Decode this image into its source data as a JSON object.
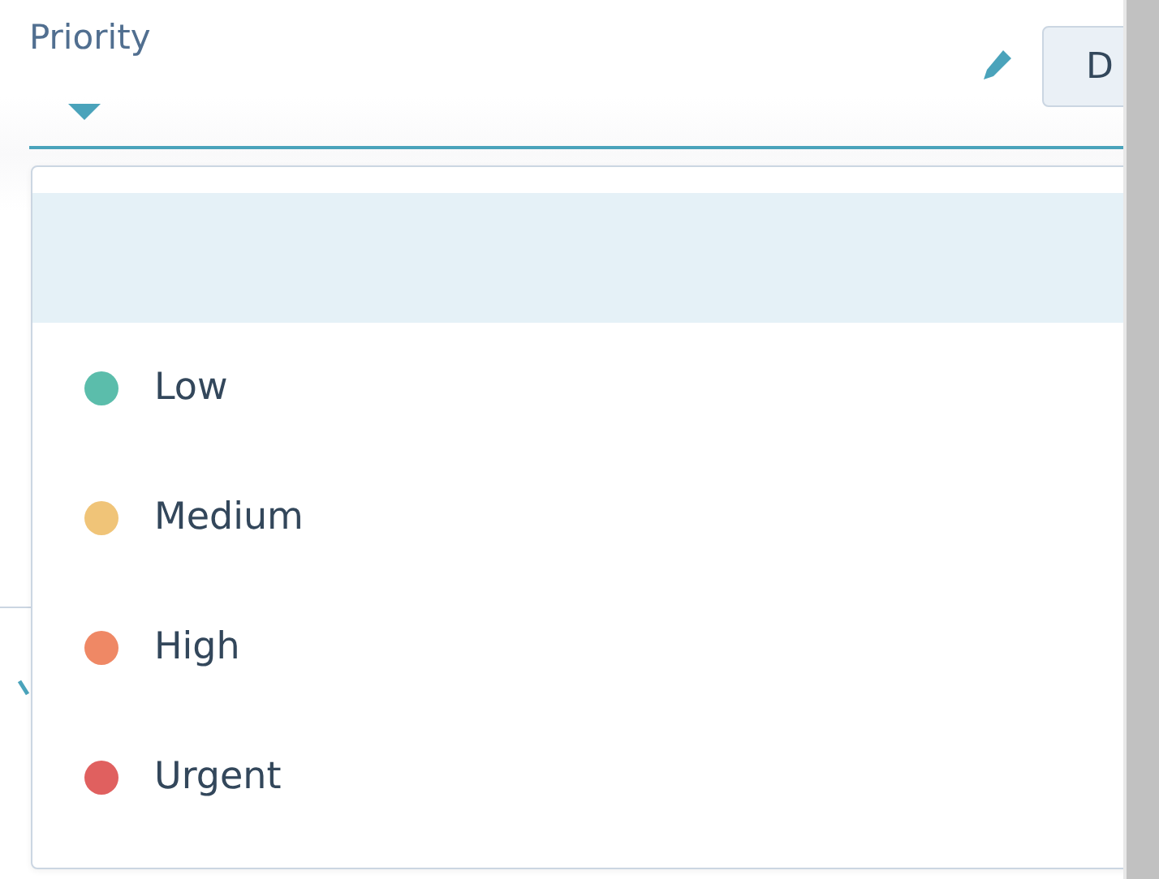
{
  "field": {
    "label": "Priority",
    "button_text": "D"
  },
  "options": [
    {
      "kind": "blank",
      "selected": true
    },
    {
      "kind": "item",
      "label": "Low",
      "color": "#5bbdab",
      "selected": false
    },
    {
      "kind": "item",
      "label": "Medium",
      "color": "#f0c478",
      "selected": false
    },
    {
      "kind": "item",
      "label": "High",
      "color": "#ef8865",
      "selected": false
    },
    {
      "kind": "item",
      "label": "Urgent",
      "color": "#e0605f",
      "selected": false
    }
  ]
}
